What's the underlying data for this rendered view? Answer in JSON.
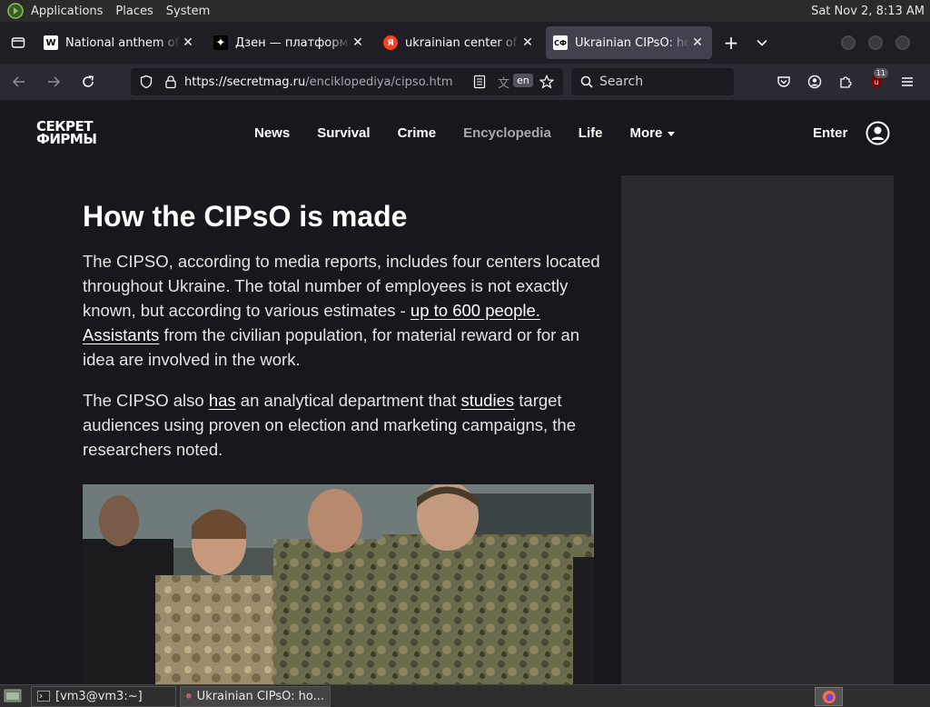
{
  "system_panel": {
    "menus": [
      "Applications",
      "Places",
      "System"
    ],
    "clock": "Sat Nov  2,  8:13 AM"
  },
  "tabs": [
    {
      "title": "National anthem of Russia",
      "favicon": "W",
      "favicon_bg": "#ffffff",
      "favicon_fg": "#000000",
      "active": false
    },
    {
      "title": "Дзен — платформа для",
      "favicon": "✦",
      "favicon_bg": "#000000",
      "favicon_fg": "#ffffff",
      "active": false
    },
    {
      "title": "ukrainian center of psy",
      "favicon": "Я",
      "favicon_bg": "#fc3f1d",
      "favicon_fg": "#ffffff",
      "active": false
    },
    {
      "title": "Ukrainian CIPsO: how it",
      "favicon": "СФ",
      "favicon_bg": "#ffffff",
      "favicon_fg": "#000000",
      "active": true
    }
  ],
  "navbar": {
    "url_host": "https://secretmag.ru",
    "url_path": "/enciklopediya/cipso.htm",
    "translate_badge": "en",
    "search_placeholder": "Search",
    "extension_badge": "11"
  },
  "site": {
    "logo_line1": "СЕКРЕТ",
    "logo_line2": "ФИРМЫ",
    "nav": [
      "News",
      "Survival",
      "Crime",
      "Encyclopedia",
      "Life",
      "More"
    ],
    "current_nav": "Encyclopedia",
    "enter_label": "Enter"
  },
  "article": {
    "heading": "How the CIPsO is made",
    "p1_before": "The CIPSO, according to media reports, includes four centers located throughout Ukraine. The total number of employees is not exactly known, but according to various estimates - ",
    "p1_link1": "up to 600 people.",
    "p1_mid": " ",
    "p1_link2": "Assistants",
    "p1_after": " from the civilian population, for material reward or for an idea are involved in the work.",
    "p2_before": "The CIPSO also ",
    "p2_link1": "has",
    "p2_mid": " an analytical department that ",
    "p2_link2": "studies",
    "p2_after": " target audiences using proven on election and marketing campaigns, the researchers noted."
  },
  "taskbar": {
    "items": [
      "[vm3@vm3:~]",
      "Ukrainian CIPsO: ho..."
    ]
  }
}
